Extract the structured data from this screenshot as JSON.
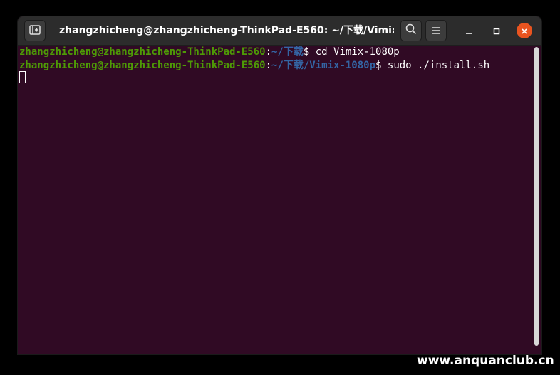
{
  "window": {
    "title": "zhangzhicheng@zhangzhicheng-ThinkPad-E560: ~/下载/Vimix-1..."
  },
  "titlebar": {
    "new_tab_icon": "new-tab-icon",
    "search_icon": "search-icon",
    "menu_icon": "hamburger-menu-icon",
    "minimize_icon": "minimize-icon",
    "maximize_icon": "maximize-icon",
    "close_icon": "close-icon"
  },
  "terminal": {
    "lines": [
      {
        "user": "zhangzhicheng@zhangzhicheng-ThinkPad-E560",
        "sep": ":",
        "path": "~/下载",
        "prompt": "$ ",
        "command": "cd Vimix-1080p"
      },
      {
        "user": "zhangzhicheng@zhangzhicheng-ThinkPad-E560",
        "sep": ":",
        "path": "~/下载/Vimix-1080p",
        "prompt": "$ ",
        "command": "sudo ./install.sh"
      }
    ]
  },
  "colors": {
    "terminal_bg": "#300a24",
    "user_green": "#4e9a06",
    "path_blue": "#3465a4",
    "close_orange": "#e95420"
  },
  "watermark": "www.anquanclub.cn"
}
